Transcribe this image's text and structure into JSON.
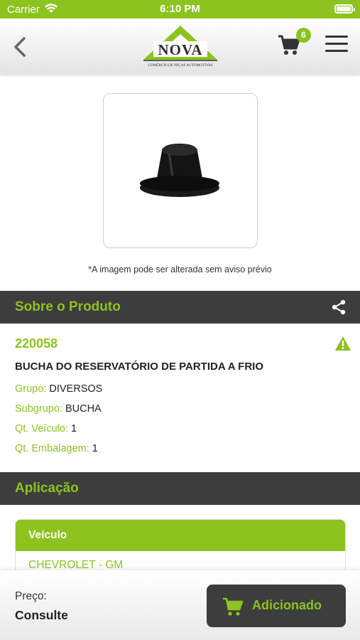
{
  "status": {
    "carrier": "Carrier",
    "time": "6:10 PM"
  },
  "header": {
    "logo_text": "NOVA",
    "logo_tagline": "COMÉRCIO DE PEÇAS AUTOMOTIVAS",
    "cart_count": "6"
  },
  "image": {
    "caption": "*A imagem pode ser alterada sem aviso prévio"
  },
  "about": {
    "title": "Sobre o Produto",
    "code": "220058",
    "name": "BUCHA DO RESERVATÓRIO DE PARTIDA A FRIO",
    "attributes": [
      {
        "label": "Grupo:",
        "value": "DIVERSOS"
      },
      {
        "label": "Subgrupo:",
        "value": "BUCHA"
      },
      {
        "label": "Qt. Veículo:",
        "value": "1"
      },
      {
        "label": "Qt. Embalagem:",
        "value": "1"
      }
    ]
  },
  "application": {
    "title": "Aplicação",
    "column": "Veículo",
    "rows": [
      "CHEVROLET - GM"
    ]
  },
  "footer": {
    "price_label": "Preço:",
    "price_value": "Consulte",
    "button_label": "Adicionado"
  },
  "colors": {
    "accent": "#8cc31e",
    "dark": "#3d3d3d"
  }
}
